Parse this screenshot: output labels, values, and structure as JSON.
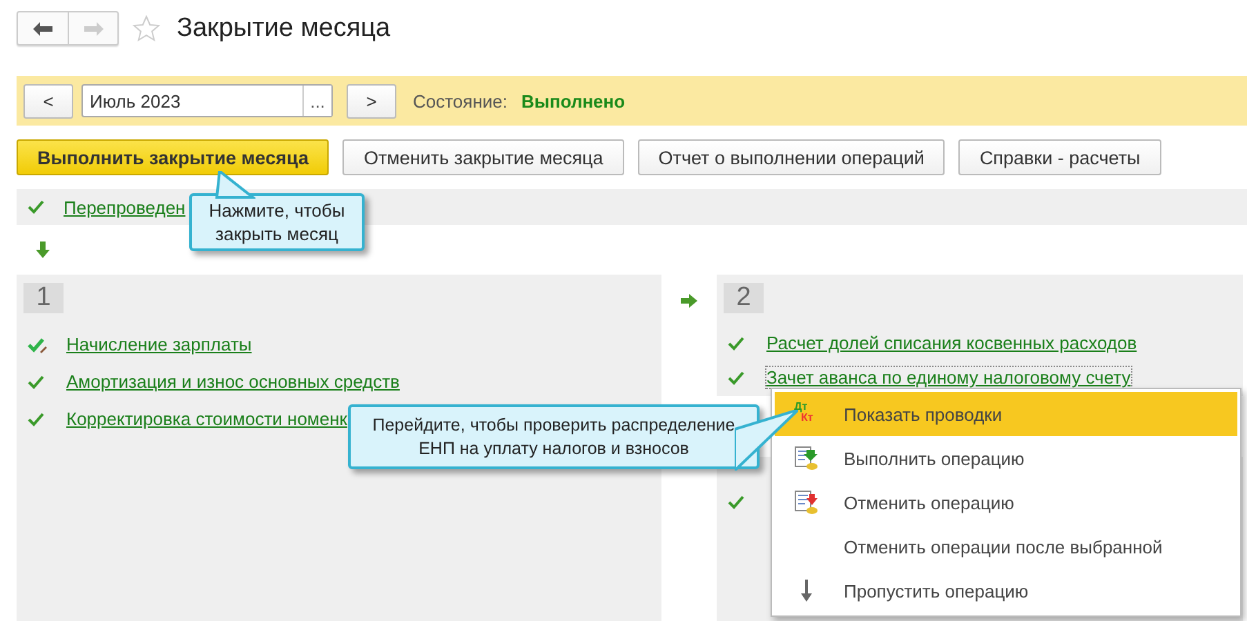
{
  "window": {
    "title": "Закрытие месяца",
    "favorite": false
  },
  "period": {
    "prev": "<",
    "value": "Июль 2023",
    "pick": "...",
    "next": ">",
    "state_label": "Состояние:",
    "state_value": "Выполнено"
  },
  "buttons": [
    {
      "label": "Выполнить закрытие месяца",
      "primary": true
    },
    {
      "label": "Отменить закрытие месяца",
      "primary": false
    },
    {
      "label": "Отчет о выполнении операций",
      "primary": false
    },
    {
      "label": "Справки - расчеты",
      "primary": false
    }
  ],
  "first_step": {
    "kind": "done",
    "label": "Перепроведен"
  },
  "stages": [
    {
      "number": "1",
      "items": [
        {
          "kind": "edited",
          "label": "Начисление зарплаты"
        },
        {
          "kind": "done",
          "label": "Амортизация и износ основных средств"
        },
        {
          "kind": "done",
          "label": "Корректировка стоимости номенк"
        }
      ]
    },
    {
      "number": "2",
      "items": [
        {
          "kind": "done",
          "label": "Расчет долей списания косвенных расходов",
          "focused": false
        },
        {
          "kind": "done",
          "label": "Зачет аванса по единому налоговому счету",
          "focused": true
        }
      ]
    },
    {
      "items": [
        {
          "kind": "done"
        }
      ]
    }
  ],
  "menu": [
    {
      "kind": "entries",
      "label": "Показать проводки",
      "selected": true,
      "icon_labels": [
        "Дт",
        "Кт"
      ]
    },
    {
      "kind": "run",
      "label": "Выполнить операцию",
      "selected": false
    },
    {
      "kind": "cancel",
      "label": "Отменить операцию",
      "selected": false
    },
    {
      "kind": "none",
      "label": "Отменить операции после выбранной",
      "selected": false
    },
    {
      "kind": "skip",
      "label": "Пропустить операцию",
      "selected": false
    }
  ],
  "callouts": [
    {
      "text": "Нажмите, чтобы закрыть месяц",
      "kind": "button"
    },
    {
      "text": "Перейдите, чтобы проверить распределение ЕНП на уплату налогов и взносов",
      "kind": "menu"
    }
  ]
}
